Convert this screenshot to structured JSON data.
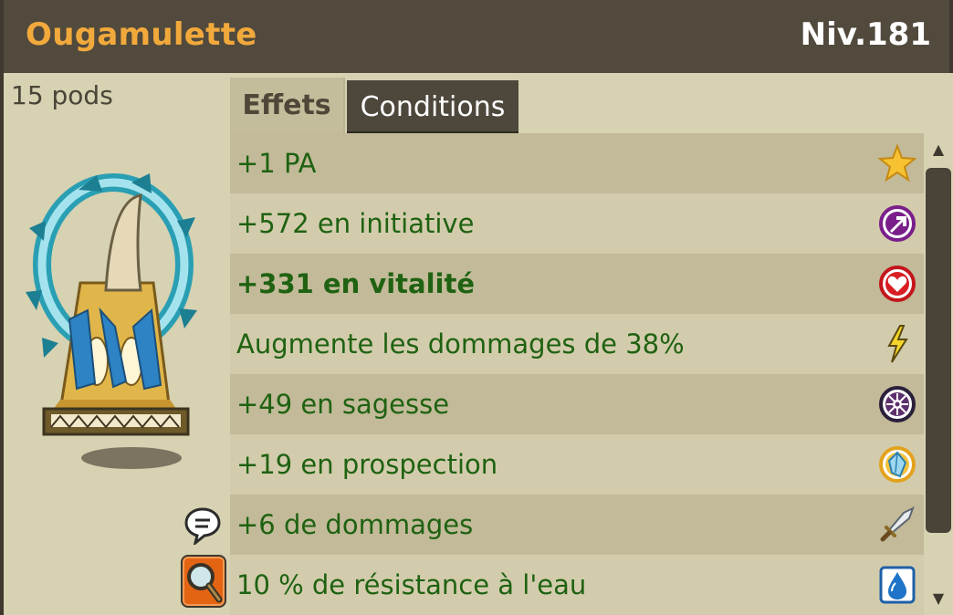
{
  "header": {
    "item_name": "Ougamulette",
    "level": "Niv.181"
  },
  "item": {
    "weight": "15 pods",
    "art_icon": "ougamulette-amulet-icon"
  },
  "tabs": [
    {
      "label": "Effets",
      "active": true
    },
    {
      "label": "Conditions",
      "active": false
    }
  ],
  "effects": [
    {
      "text": "+1 PA",
      "icon": "star-icon",
      "bold": false
    },
    {
      "text": "+572 en initiative",
      "icon": "initiative-arrow-icon",
      "bold": false
    },
    {
      "text": "+331 en vitalité",
      "icon": "heart-icon",
      "bold": true
    },
    {
      "text": "Augmente les dommages de 38%",
      "icon": "lightning-icon",
      "bold": false
    },
    {
      "text": "+49 en sagesse",
      "icon": "wisdom-icon",
      "bold": false
    },
    {
      "text": "+19 en prospection",
      "icon": "prospecting-gem-icon",
      "bold": false
    },
    {
      "text": "+6 de dommages",
      "icon": "sword-icon",
      "bold": false
    },
    {
      "text": "10 % de résistance à l'eau",
      "icon": "water-drop-icon",
      "bold": false
    }
  ],
  "scroll": {
    "up_glyph": "▲",
    "down_glyph": "▼"
  },
  "colors": {
    "header_bg": "#514a3d",
    "item_name": "#f2a93c",
    "effect_text": "#1f6212",
    "panel_bg": "#d6d2b2",
    "active_tab_bg": "#4e483c"
  }
}
